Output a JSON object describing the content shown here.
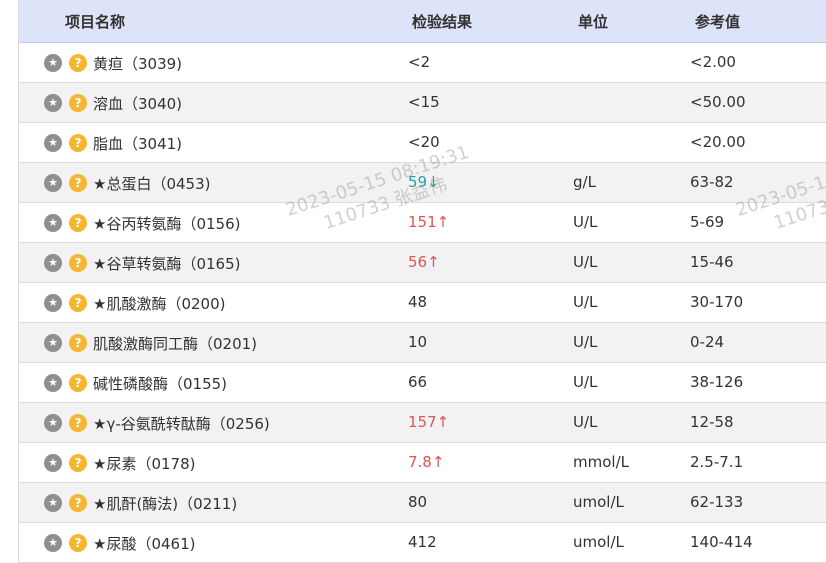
{
  "header": {
    "name": "项目名称",
    "result": "检验结果",
    "unit": "单位",
    "reference": "参考值"
  },
  "rows": [
    {
      "name": "黄疸（3039)",
      "result": "<2",
      "arrow": "",
      "flag": "normal",
      "unit": "",
      "reference": "<2.00"
    },
    {
      "name": "溶血（3040)",
      "result": "<15",
      "arrow": "",
      "flag": "normal",
      "unit": "",
      "reference": "<50.00"
    },
    {
      "name": "脂血（3041)",
      "result": "<20",
      "arrow": "",
      "flag": "normal",
      "unit": "",
      "reference": "<20.00"
    },
    {
      "name": "★总蛋白（0453)",
      "result": "59",
      "arrow": "↓",
      "flag": "low",
      "unit": "g/L",
      "reference": "63-82"
    },
    {
      "name": "★谷丙转氨酶（0156)",
      "result": "151",
      "arrow": "↑",
      "flag": "high",
      "unit": "U/L",
      "reference": "5-69"
    },
    {
      "name": "★谷草转氨酶（0165)",
      "result": "56",
      "arrow": "↑",
      "flag": "high",
      "unit": "U/L",
      "reference": "15-46"
    },
    {
      "name": "★肌酸激酶（0200)",
      "result": "48",
      "arrow": "",
      "flag": "normal",
      "unit": "U/L",
      "reference": "30-170"
    },
    {
      "name": "肌酸激酶同工酶（0201)",
      "result": "10",
      "arrow": "",
      "flag": "normal",
      "unit": "U/L",
      "reference": "0-24"
    },
    {
      "name": "碱性磷酸酶（0155)",
      "result": "66",
      "arrow": "",
      "flag": "normal",
      "unit": "U/L",
      "reference": "38-126"
    },
    {
      "name": "★γ-谷氨酰转酞酶（0256)",
      "result": "157",
      "arrow": "↑",
      "flag": "high",
      "unit": "U/L",
      "reference": "12-58"
    },
    {
      "name": "★尿素（0178)",
      "result": "7.8",
      "arrow": "↑",
      "flag": "high",
      "unit": "mmol/L",
      "reference": "2.5-7.1"
    },
    {
      "name": "★肌酐(酶法)（0211)",
      "result": "80",
      "arrow": "",
      "flag": "normal",
      "unit": "umol/L",
      "reference": "62-133"
    },
    {
      "name": "★尿酸（0461)",
      "result": "412",
      "arrow": "",
      "flag": "normal",
      "unit": "umol/L",
      "reference": "140-414"
    }
  ],
  "icons": {
    "star": "star-icon",
    "help": "question-icon"
  },
  "colors": {
    "header_bg": "#dde3f8",
    "high": "#e05555",
    "low": "#20a0a8",
    "help_icon": "#f5b731",
    "star_icon": "#8f8f8f"
  },
  "watermark": {
    "line1": "2023-05-15 08:19:31",
    "line2": "110733 张益伟",
    "line1_partial": "2023-05-1",
    "line2_partial": "110733"
  }
}
